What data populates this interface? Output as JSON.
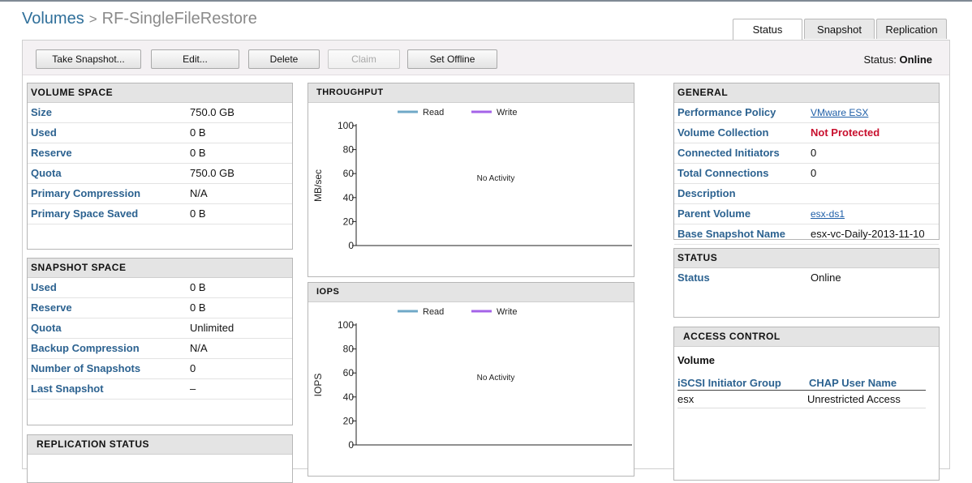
{
  "breadcrumb": {
    "root": "Volumes",
    "separator": ">",
    "current": "RF-SingleFileRestore"
  },
  "tabs": [
    {
      "label": "Status"
    },
    {
      "label": "Snapshot"
    },
    {
      "label": "Replication"
    }
  ],
  "toolbar": {
    "take_snapshot": "Take Snapshot...",
    "edit": "Edit...",
    "delete": "Delete",
    "claim": "Claim",
    "set_offline": "Set Offline",
    "status_label": "Status:",
    "status_value": "Online"
  },
  "volume_space": {
    "title": "VOLUME SPACE",
    "rows": [
      {
        "k": "Size",
        "v": "750.0 GB"
      },
      {
        "k": "Used",
        "v": "0 B"
      },
      {
        "k": "Reserve",
        "v": "0 B"
      },
      {
        "k": "Quota",
        "v": "750.0 GB"
      },
      {
        "k": "Primary Compression",
        "v": "N/A"
      },
      {
        "k": "Primary Space Saved",
        "v": "0 B"
      }
    ]
  },
  "snapshot_space": {
    "title": "SNAPSHOT SPACE",
    "rows": [
      {
        "k": "Used",
        "v": "0 B"
      },
      {
        "k": "Reserve",
        "v": "0 B"
      },
      {
        "k": "Quota",
        "v": "Unlimited"
      },
      {
        "k": "Backup Compression",
        "v": "N/A"
      },
      {
        "k": "Number of Snapshots",
        "v": "0"
      },
      {
        "k": "Last Snapshot",
        "v": "–"
      }
    ]
  },
  "replication_status": {
    "title": "REPLICATION STATUS"
  },
  "throughput": {
    "title": "THROUGHPUT"
  },
  "iops": {
    "title": "IOPS"
  },
  "chart_data": [
    {
      "type": "line",
      "title": "THROUGHPUT",
      "ylabel": "MB/sec",
      "xlabel": "",
      "ylim": [
        0,
        100
      ],
      "yticks": [
        "100",
        "80",
        "60",
        "40",
        "20",
        "0"
      ],
      "series": [
        {
          "name": "Read",
          "color": "#6fa8c7",
          "values": []
        },
        {
          "name": "Write",
          "color": "#a463e8",
          "values": []
        }
      ],
      "annotation": "No Activity",
      "grid": false,
      "legend": "top"
    },
    {
      "type": "line",
      "title": "IOPS",
      "ylabel": "IOPS",
      "xlabel": "",
      "ylim": [
        0,
        100
      ],
      "yticks": [
        "100",
        "80",
        "60",
        "40",
        "20",
        "0"
      ],
      "series": [
        {
          "name": "Read",
          "color": "#6fa8c7",
          "values": []
        },
        {
          "name": "Write",
          "color": "#a463e8",
          "values": []
        }
      ],
      "annotation": "No Activity",
      "grid": false,
      "legend": "top"
    }
  ],
  "general": {
    "title": "GENERAL",
    "rows": [
      {
        "k": "Performance Policy",
        "v": "VMware ESX",
        "style": "link"
      },
      {
        "k": "Volume Collection",
        "v": "Not Protected",
        "style": "red"
      },
      {
        "k": "Connected Initiators",
        "v": "0",
        "style": ""
      },
      {
        "k": "Total Connections",
        "v": "0",
        "style": ""
      },
      {
        "k": "Description",
        "v": "",
        "style": ""
      },
      {
        "k": "Parent Volume",
        "v": "esx-ds1",
        "style": "link"
      },
      {
        "k": "Base Snapshot Name",
        "v": "esx-vc-Daily-2013-11-10",
        "style": ""
      }
    ]
  },
  "status_panel": {
    "title": "STATUS",
    "rows": [
      {
        "k": "Status",
        "v": "Online"
      }
    ]
  },
  "access_control": {
    "title": "ACCESS CONTROL",
    "subheading": "Volume",
    "col1": "iSCSI Initiator Group",
    "col2": "CHAP User Name",
    "rows": [
      {
        "group": "esx",
        "chap": "Unrestricted Access"
      }
    ]
  },
  "colors": {
    "accent": "#2c6290",
    "title_blue": "#2f6f9a",
    "error_red": "#c8102e",
    "read": "#6fa8c7",
    "write": "#a463e8"
  }
}
